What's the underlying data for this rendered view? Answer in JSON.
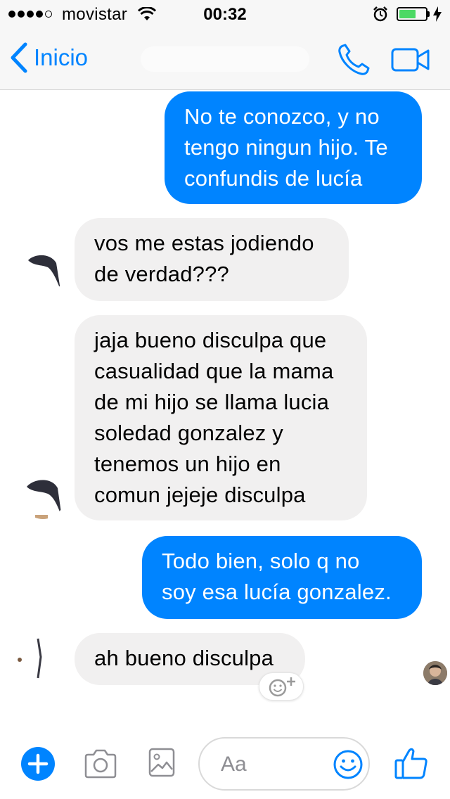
{
  "status_bar": {
    "carrier": "movistar",
    "time": "00:32",
    "battery_level": 0.65,
    "signal_bars_filled": 4,
    "signal_bars_total": 5
  },
  "nav": {
    "back_label": "Inicio",
    "back_icon": "chevron-left-icon",
    "call_icon": "phone-icon",
    "video_icon": "video-camera-icon"
  },
  "messages": [
    {
      "direction": "outgoing",
      "lines": [
        "No te conozco, y no",
        "tengo ningun hijo. Te",
        "confundis de lucía"
      ]
    },
    {
      "direction": "incoming",
      "lines": [
        "vos me estas jodiendo",
        "de verdad???"
      ]
    },
    {
      "direction": "incoming",
      "lines": [
        "jaja bueno disculpa que",
        "casualidad que la mama",
        "de mi hijo se llama lucia",
        "soledad gonzalez y",
        "tenemos un hijo en",
        "comun jejeje disculpa"
      ]
    },
    {
      "direction": "outgoing",
      "lines": [
        "Todo bien, solo q no",
        "soy esa lucía gonzalez."
      ]
    },
    {
      "direction": "incoming",
      "lines": [
        "ah bueno disculpa"
      ]
    }
  ],
  "composer": {
    "placeholder": "Aa",
    "icons": [
      "plus-icon",
      "camera-icon",
      "image-icon",
      "emoji-icon",
      "thumbs-up-icon"
    ]
  },
  "colors": {
    "outgoing_bubble": "#0084ff",
    "incoming_bubble": "#f1f0f0",
    "accent": "#0084ff",
    "battery": "#4cd964"
  }
}
